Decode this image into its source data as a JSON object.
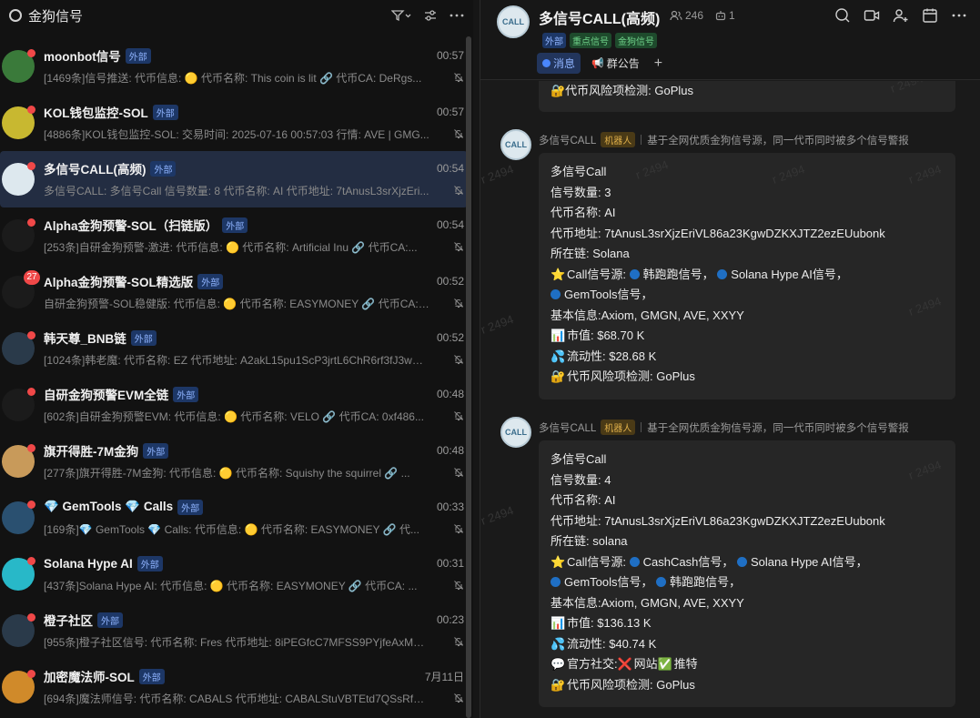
{
  "left_panel": {
    "title": "金狗信号",
    "conversations": [
      {
        "name": "moonbot信号",
        "tag": "外部",
        "time": "00:57",
        "preview": "[1469条]信号推送: 代币信息: 🟡 代币名称: This coin is lit 🔗 代币CA: DeRgs...",
        "avatar_color": "#3a7a3a",
        "badge": ""
      },
      {
        "name": "KOL钱包监控-SOL",
        "tag": "外部",
        "time": "00:57",
        "preview": "[4886条]KOL钱包监控-SOL: 交易时间: 2025-07-16 00:57:03 行情: AVE | GMG...",
        "avatar_color": "#c8b830",
        "badge": ""
      },
      {
        "name": "多信号CALL(高频)",
        "tag": "外部",
        "time": "00:54",
        "preview": "多信号CALL: 多信号Call 信号数量: 8 代币名称: AI 代币地址: 7tAnusL3srXjzEri...",
        "avatar_color": "#dde8ee",
        "badge": ""
      },
      {
        "name": "Alpha金狗预警-SOL（扫链版）",
        "tag": "外部",
        "time": "00:54",
        "preview": "[253条]自研金狗预警-激进: 代币信息: 🟡 代币名称: Artificial Inu 🔗 代币CA:...",
        "avatar_color": "#1b1b1b",
        "badge": ""
      },
      {
        "name": "Alpha金狗预警-SOL精选版",
        "tag": "外部",
        "time": "00:52",
        "preview": "自研金狗预警-SOL稳健版: 代币信息: 🟡 代币名称: EASYMONEY 🔗 代币CA: 💡 代...",
        "avatar_color": "#1b1b1b",
        "badge": "27"
      },
      {
        "name": "韩天尊_BNB链",
        "tag": "外部",
        "time": "00:52",
        "preview": "[1024条]韩老魔: 代币名称: EZ 代币地址: A2akL15pu1ScP3jrtL6ChR6rf3fJ3wM...",
        "avatar_color": "#2a3a4a",
        "badge": ""
      },
      {
        "name": "自研金狗预警EVM全链",
        "tag": "外部",
        "time": "00:48",
        "preview": "[602条]自研金狗预警EVM: 代币信息: 🟡 代币名称: VELO 🔗 代币CA: 0xf486...",
        "avatar_color": "#1b1b1b",
        "badge": ""
      },
      {
        "name": "旗开得胜-7M金狗",
        "tag": "外部",
        "time": "00:48",
        "preview": "[277条]旗开得胜-7M金狗: 代币信息: 🟡 代币名称: Squishy the squirrel 🔗 ...",
        "avatar_color": "#c89a5a",
        "badge": ""
      },
      {
        "name": "💎 GemTools 💎 Calls",
        "tag": "外部",
        "time": "00:33",
        "preview": "[169条]💎 GemTools 💎 Calls: 代币信息: 🟡 代币名称: EASYMONEY 🔗 代...",
        "avatar_color": "#2a5070",
        "badge": ""
      },
      {
        "name": "Solana Hype AI",
        "tag": "外部",
        "time": "00:31",
        "preview": "[437条]Solana Hype AI: 代币信息: 🟡 代币名称: EASYMONEY 🔗 代币CA: ...",
        "avatar_color": "#28b8c8",
        "badge": ""
      },
      {
        "name": "橙子社区",
        "tag": "外部",
        "time": "00:23",
        "preview": "[955条]橙子社区信号: 代币名称: Fres 代币地址: 8iPEGfcC7MFSS9PYjfeAxM3w...",
        "avatar_color": "#2a3a4a",
        "badge": ""
      },
      {
        "name": "加密魔法师-SOL",
        "tag": "外部",
        "time": "7月11日",
        "preview": "[694条]魔法师信号: 代币名称: CABALS 代币地址: CABALStuVBTEtd7QSsRfeW...",
        "avatar_color": "#d08a2a",
        "badge": ""
      }
    ]
  },
  "chat": {
    "title": "多信号CALL(高频)",
    "avatar_text": "CALL",
    "member_count": "246",
    "bot_count": "1",
    "tags": [
      "外部",
      "重点信号",
      "金狗信号"
    ],
    "tabs": [
      {
        "label": "消息",
        "active": true
      },
      {
        "label": "群公告",
        "active": false
      }
    ],
    "add_tab": "+",
    "partial_line": "🔐代币风险项检测: GoPlus",
    "watermark": "r 2494",
    "messages": [
      {
        "sender": "多信号CALL",
        "role": "机器人",
        "desc": "基于全网优质金狗信号源，同一代币同时被多个信号警报",
        "title": "多信号Call",
        "count": "信号数量: 3",
        "token": "代币名称: AI",
        "address": "代币地址: 7tAnusL3srXjzEriVL86a23KgwDZKXJTZ2ezEUubonk",
        "chain": "所在链: Solana",
        "sources_label": "Call信号源:",
        "sources_line1": [
          "韩跑跑信号，",
          "Solana Hype AI信号，"
        ],
        "sources_line2": [
          "GemTools信号，"
        ],
        "basic": "基本信息:Axiom, GMGN, AVE, XXYY",
        "mcap": "市值: $68.70 K",
        "liq": "流动性: $28.68 K",
        "risk": "代币风险项检测: GoPlus"
      },
      {
        "sender": "多信号CALL",
        "role": "机器人",
        "desc": "基于全网优质金狗信号源，同一代币同时被多个信号警报",
        "title": "多信号Call",
        "count": "信号数量: 4",
        "token": "代币名称: AI",
        "address": "代币地址: 7tAnusL3srXjzEriVL86a23KgwDZKXJTZ2ezEUubonk",
        "chain": "所在链: solana",
        "sources_label": "Call信号源:",
        "sources_line1": [
          "CashCash信号，",
          "Solana Hype AI信号，"
        ],
        "sources_line2": [
          "GemTools信号，",
          "韩跑跑信号，"
        ],
        "basic": "基本信息:Axiom, GMGN, AVE, XXYY",
        "mcap": "市值: $136.13 K",
        "liq": "流动性: $40.74 K",
        "social_label": "官方社交:",
        "social_web": "网站",
        "social_tw": "推特",
        "risk": "代币风险项检测: GoPlus"
      }
    ]
  },
  "colors": {
    "accent": "#4a87ff",
    "bubble": "#262626",
    "badge_red": "#f04848",
    "bot_tag": "#e0b04a"
  }
}
